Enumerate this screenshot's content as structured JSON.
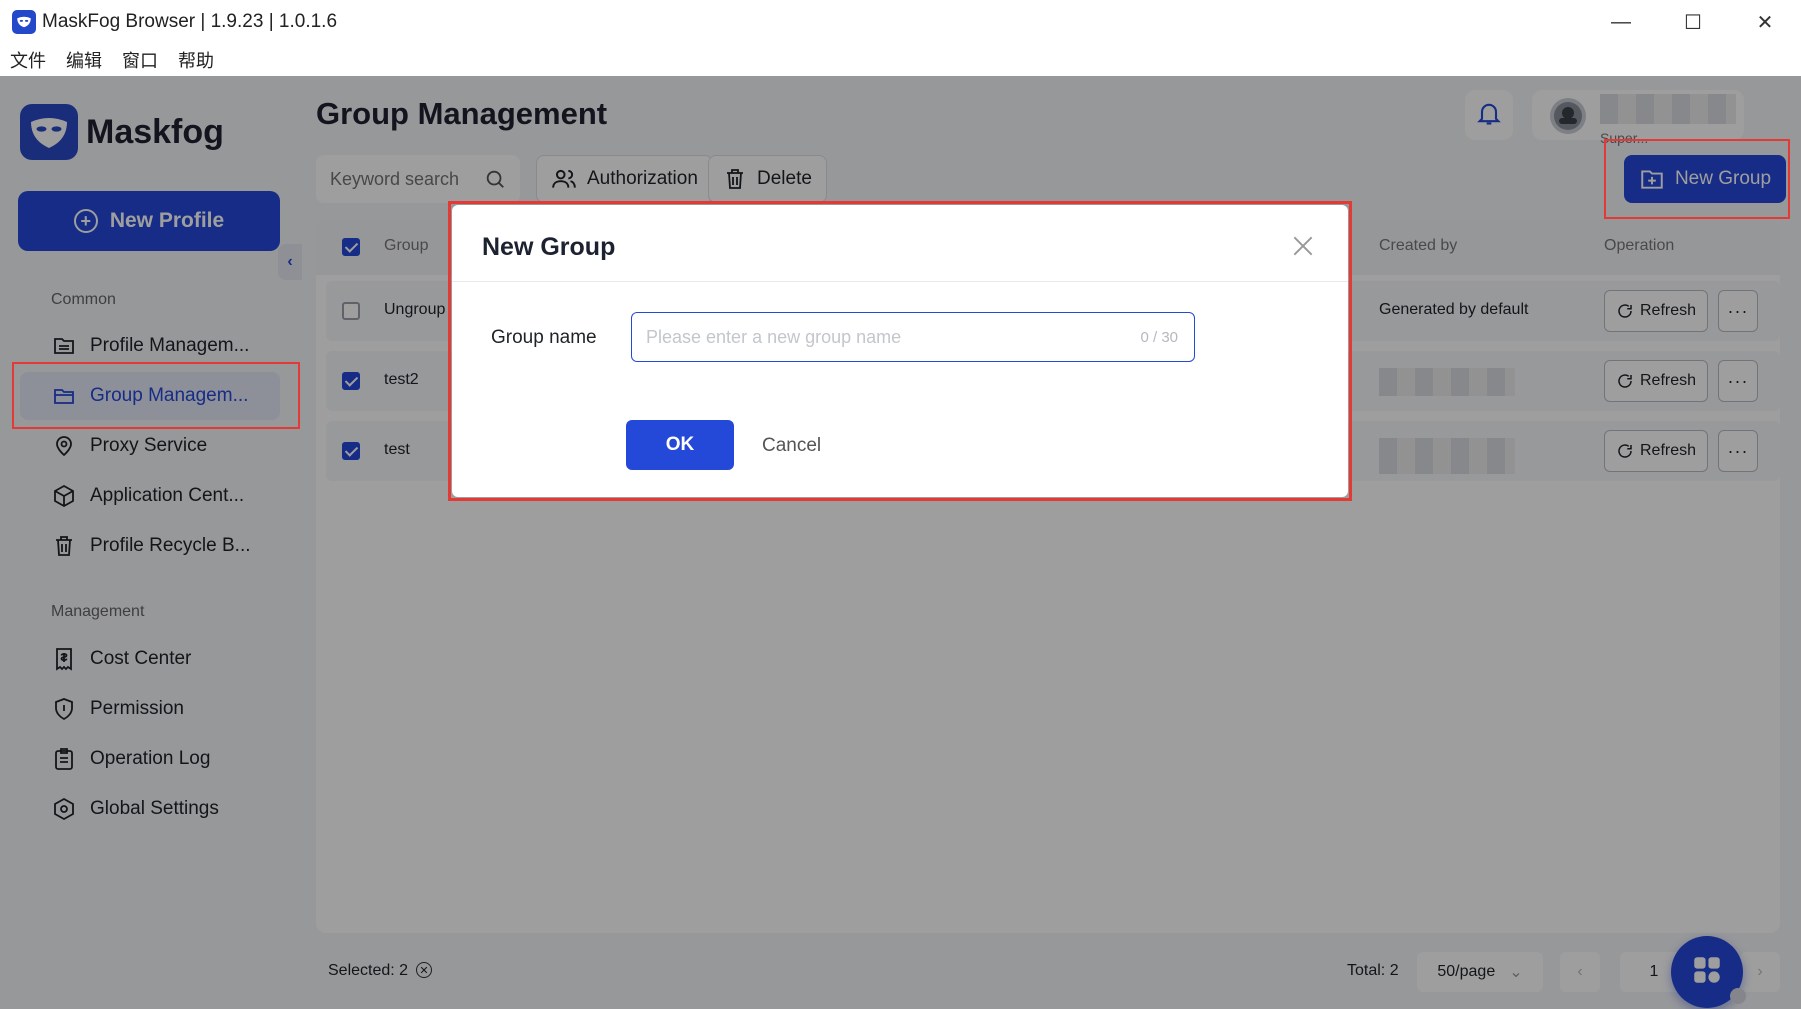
{
  "window": {
    "title": "MaskFog Browser | 1.9.23 | 1.0.1.6",
    "minimize": "—",
    "maximize": "☐",
    "close": "✕"
  },
  "menu": [
    "文件",
    "编辑",
    "窗口",
    "帮助"
  ],
  "sidebar": {
    "logo_text": "Maskfog",
    "new_profile_label": "New Profile",
    "common_label": "Common",
    "common_items": [
      {
        "label": "Profile Managem...",
        "icon": "folder-list-icon"
      },
      {
        "label": "Group Managem...",
        "icon": "folder-open-icon",
        "active": true
      },
      {
        "label": "Proxy Service",
        "icon": "location-pin-icon"
      },
      {
        "label": "Application Cent...",
        "icon": "cube-icon"
      },
      {
        "label": "Profile Recycle B...",
        "icon": "trash-icon"
      }
    ],
    "management_label": "Management",
    "management_items": [
      {
        "label": "Cost Center",
        "icon": "receipt-icon"
      },
      {
        "label": "Permission",
        "icon": "shield-icon"
      },
      {
        "label": "Operation Log",
        "icon": "clipboard-icon"
      },
      {
        "label": "Global Settings",
        "icon": "gear-hexagon-icon"
      }
    ]
  },
  "header": {
    "page_title": "Group Management",
    "user_role": "Super..."
  },
  "toolbar": {
    "search_placeholder": "Keyword search",
    "authorization_label": "Authorization",
    "delete_label": "Delete",
    "new_group_label": "New Group"
  },
  "table": {
    "columns": {
      "group": "Group",
      "created_by": "Created by",
      "operation": "Operation"
    },
    "rows": [
      {
        "group": "Ungroup",
        "created_by": "Generated by default",
        "checked": false
      },
      {
        "group": "test2",
        "created_by": "",
        "checked": true
      },
      {
        "group": "test",
        "created_by": "",
        "checked": true
      }
    ],
    "refresh_label": "Refresh",
    "more_label": "···"
  },
  "footer": {
    "selected": "Selected: 2",
    "total": "Total: 2",
    "page_size": "50/page",
    "current_page": "1",
    "total_pages": "/ 1"
  },
  "dialog": {
    "title": "New Group",
    "field_label": "Group name",
    "field_placeholder": "Please enter a new group name",
    "field_value": "",
    "char_count": "0 / 30",
    "ok_label": "OK",
    "cancel_label": "Cancel"
  },
  "colors": {
    "accent": "#2448d8",
    "highlight": "#e53935"
  }
}
